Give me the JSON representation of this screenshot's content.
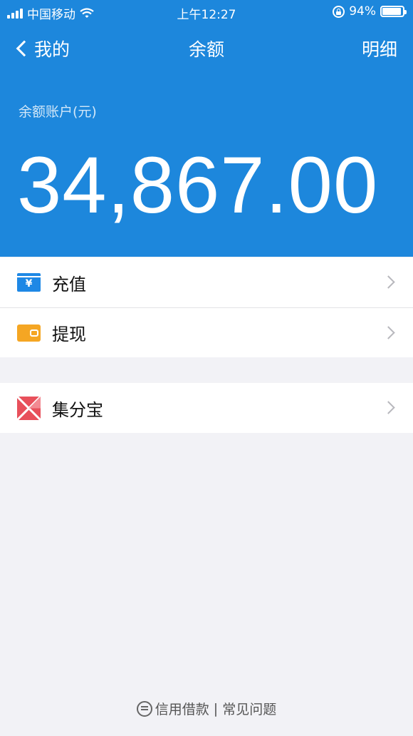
{
  "status_bar": {
    "carrier": "中国移动",
    "time": "上午12:27",
    "battery_percent": "94%",
    "battery_level": 0.94
  },
  "nav": {
    "back_label": "我的",
    "title": "余额",
    "right_label": "明细"
  },
  "balance": {
    "label": "余额账户(元)",
    "amount": "34,867.00"
  },
  "menu_group_1": [
    {
      "label": "充值",
      "icon": "recharge-icon"
    },
    {
      "label": "提现",
      "icon": "withdraw-icon"
    }
  ],
  "menu_group_2": [
    {
      "label": "集分宝",
      "icon": "jifenbao-icon"
    }
  ],
  "footer": {
    "link1": "信用借款",
    "separator": "|",
    "link2": "常见问题"
  },
  "colors": {
    "header_bg": "#1d87dc",
    "page_bg": "#f2f2f6",
    "recharge_icon": "#1e88e5",
    "withdraw_icon": "#f5a623",
    "jifenbao_icon": "#e8505b"
  }
}
